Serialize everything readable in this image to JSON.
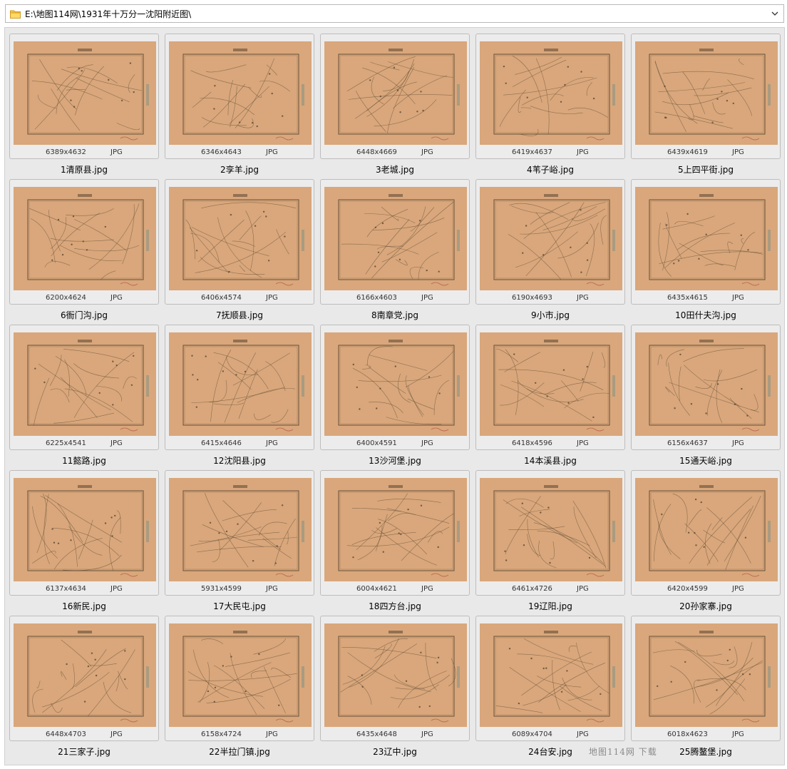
{
  "address": {
    "path": "E:\\地图114网\\1931年十万分一沈阳附近图\\",
    "folder_icon": "folder-icon",
    "dropdown_icon": "chevron-down-icon"
  },
  "colors": {
    "map_paper": "#d9a77b",
    "map_ink": "#5a4632",
    "pane_bg": "#e9e9e9"
  },
  "files": [
    {
      "name": "1清原县.jpg",
      "dims": "6389x4632",
      "type": "JPG"
    },
    {
      "name": "2孪羊.jpg",
      "dims": "6346x4643",
      "type": "JPG"
    },
    {
      "name": "3老城.jpg",
      "dims": "6448x4669",
      "type": "JPG"
    },
    {
      "name": "4苇子峪.jpg",
      "dims": "6419x4637",
      "type": "JPG"
    },
    {
      "name": "5上四平街.jpg",
      "dims": "6439x4619",
      "type": "JPG"
    },
    {
      "name": "6衙门沟.jpg",
      "dims": "6200x4624",
      "type": "JPG"
    },
    {
      "name": "7抚顺县.jpg",
      "dims": "6406x4574",
      "type": "JPG"
    },
    {
      "name": "8南章党.jpg",
      "dims": "6166x4603",
      "type": "JPG"
    },
    {
      "name": "9小市.jpg",
      "dims": "6190x4693",
      "type": "JPG"
    },
    {
      "name": "10田什夫沟.jpg",
      "dims": "6435x4615",
      "type": "JPG"
    },
    {
      "name": "11懿路.jpg",
      "dims": "6225x4541",
      "type": "JPG"
    },
    {
      "name": "12沈阳县.jpg",
      "dims": "6415x4646",
      "type": "JPG"
    },
    {
      "name": "13沙河堡.jpg",
      "dims": "6400x4591",
      "type": "JPG"
    },
    {
      "name": "14本溪县.jpg",
      "dims": "6418x4596",
      "type": "JPG"
    },
    {
      "name": "15通天峪.jpg",
      "dims": "6156x4637",
      "type": "JPG"
    },
    {
      "name": "16新民.jpg",
      "dims": "6137x4634",
      "type": "JPG"
    },
    {
      "name": "17大民屯.jpg",
      "dims": "5931x4599",
      "type": "JPG"
    },
    {
      "name": "18四方台.jpg",
      "dims": "6004x4621",
      "type": "JPG"
    },
    {
      "name": "19辽阳.jpg",
      "dims": "6461x4726",
      "type": "JPG"
    },
    {
      "name": "20孙家寨.jpg",
      "dims": "6420x4599",
      "type": "JPG"
    },
    {
      "name": "21三家子.jpg",
      "dims": "6448x4703",
      "type": "JPG"
    },
    {
      "name": "22半拉门镇.jpg",
      "dims": "6158x4724",
      "type": "JPG"
    },
    {
      "name": "23辽中.jpg",
      "dims": "6435x4648",
      "type": "JPG"
    },
    {
      "name": "24台安.jpg",
      "dims": "6089x4704",
      "type": "JPG"
    },
    {
      "name": "25腾鳌堡.jpg",
      "dims": "6018x4623",
      "type": "JPG"
    }
  ],
  "watermark": "地图114网 下载"
}
